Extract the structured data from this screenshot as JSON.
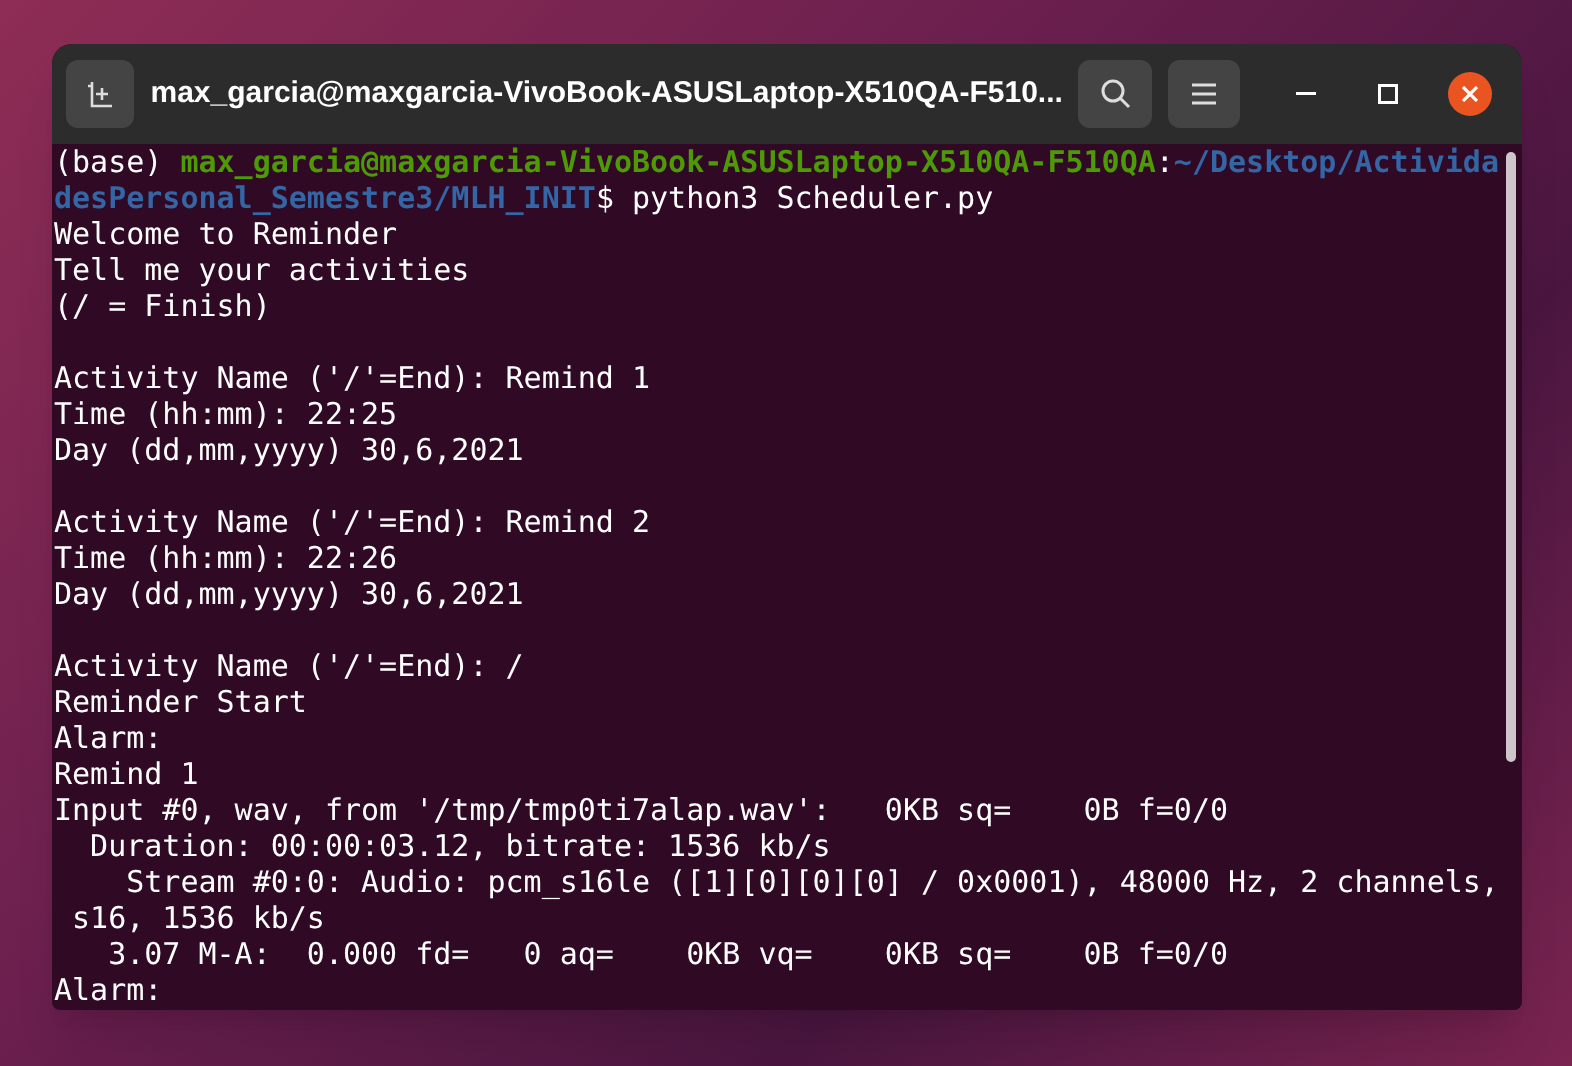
{
  "window": {
    "title": "max_garcia@maxgarcia-VivoBook-ASUSLaptop-X510QA-F510..."
  },
  "terminal": {
    "lines": [
      {
        "kind": "text",
        "segments": [
          {
            "kind": "plain",
            "text": "(base) "
          },
          {
            "kind": "user",
            "text": "max_garcia@maxgarcia-VivoBook-ASUSLaptop-X510QA-F510QA"
          },
          {
            "kind": "plain",
            "text": ":"
          },
          {
            "kind": "path",
            "text": "~/Desktop/Activida"
          }
        ]
      },
      {
        "kind": "text",
        "segments": [
          {
            "kind": "path",
            "text": "desPersonal_Semestre3/MLH_INIT"
          },
          {
            "kind": "plain",
            "text": "$ python3 Scheduler.py"
          }
        ]
      },
      {
        "kind": "text",
        "segments": [
          {
            "kind": "plain",
            "text": "Welcome to Reminder"
          }
        ]
      },
      {
        "kind": "text",
        "segments": [
          {
            "kind": "plain",
            "text": "Tell me your activities"
          }
        ]
      },
      {
        "kind": "text",
        "segments": [
          {
            "kind": "plain",
            "text": "(/ = Finish)"
          }
        ]
      },
      {
        "kind": "blank"
      },
      {
        "kind": "text",
        "segments": [
          {
            "kind": "plain",
            "text": "Activity Name ('/'=End): Remind 1"
          }
        ]
      },
      {
        "kind": "text",
        "segments": [
          {
            "kind": "plain",
            "text": "Time (hh:mm): 22:25"
          }
        ]
      },
      {
        "kind": "text",
        "segments": [
          {
            "kind": "plain",
            "text": "Day (dd,mm,yyyy) 30,6,2021"
          }
        ]
      },
      {
        "kind": "blank"
      },
      {
        "kind": "text",
        "segments": [
          {
            "kind": "plain",
            "text": "Activity Name ('/'=End): Remind 2"
          }
        ]
      },
      {
        "kind": "text",
        "segments": [
          {
            "kind": "plain",
            "text": "Time (hh:mm): 22:26"
          }
        ]
      },
      {
        "kind": "text",
        "segments": [
          {
            "kind": "plain",
            "text": "Day (dd,mm,yyyy) 30,6,2021"
          }
        ]
      },
      {
        "kind": "blank"
      },
      {
        "kind": "text",
        "segments": [
          {
            "kind": "plain",
            "text": "Activity Name ('/'=End): /"
          }
        ]
      },
      {
        "kind": "text",
        "segments": [
          {
            "kind": "plain",
            "text": "Reminder Start"
          }
        ]
      },
      {
        "kind": "text",
        "segments": [
          {
            "kind": "plain",
            "text": "Alarm:"
          }
        ]
      },
      {
        "kind": "text",
        "segments": [
          {
            "kind": "plain",
            "text": "Remind 1"
          }
        ]
      },
      {
        "kind": "text",
        "segments": [
          {
            "kind": "plain",
            "text": "Input #0, wav, from '/tmp/tmp0ti7alap.wav':   0KB sq=    0B f=0/0"
          }
        ]
      },
      {
        "kind": "text",
        "segments": [
          {
            "kind": "plain",
            "text": "  Duration: 00:00:03.12, bitrate: 1536 kb/s"
          }
        ]
      },
      {
        "kind": "text",
        "segments": [
          {
            "kind": "plain",
            "text": "    Stream #0:0: Audio: pcm_s16le ([1][0][0][0] / 0x0001), 48000 Hz, 2 channels,"
          }
        ]
      },
      {
        "kind": "text",
        "segments": [
          {
            "kind": "plain",
            "text": " s16, 1536 kb/s"
          }
        ]
      },
      {
        "kind": "text",
        "segments": [
          {
            "kind": "plain",
            "text": "   3.07 M-A:  0.000 fd=   0 aq=    0KB vq=    0KB sq=    0B f=0/0"
          }
        ]
      },
      {
        "kind": "text",
        "segments": [
          {
            "kind": "plain",
            "text": "Alarm:"
          }
        ]
      }
    ]
  }
}
